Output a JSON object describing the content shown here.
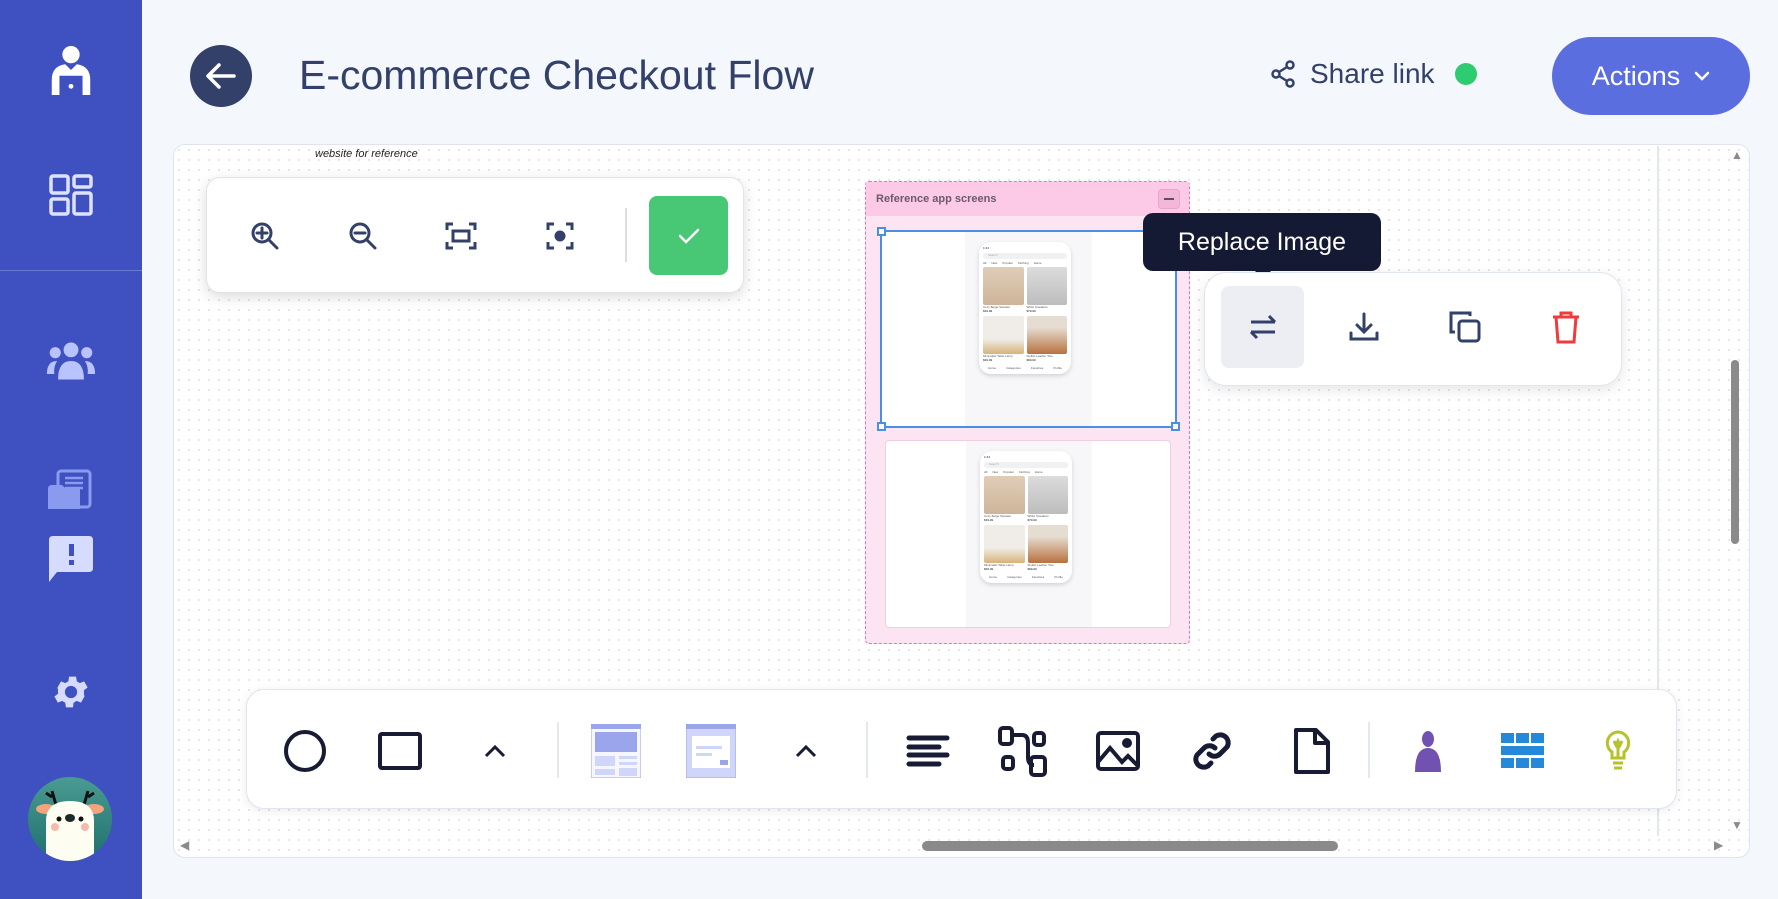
{
  "header": {
    "title": "E-commerce Checkout Flow",
    "share_label": "Share link",
    "actions_label": "Actions"
  },
  "canvas": {
    "note": "website for reference",
    "group": {
      "title": "Reference app screens"
    },
    "phone": {
      "search_placeholder": "Search",
      "tabs": [
        "All",
        "New",
        "Popular",
        "Clothing",
        "Home"
      ],
      "products": [
        {
          "name": "Cozy Beige Sweater",
          "price": "$49.99"
        },
        {
          "name": "White Sneakers",
          "price": "$79.99"
        },
        {
          "name": "Minimalist Table Lamp",
          "price": "$39.99"
        },
        {
          "name": "Stylish Leather Tote",
          "price": "$89.99"
        }
      ],
      "nav": [
        "Home",
        "Categories",
        "Favorites",
        "Profile"
      ]
    },
    "tooltip": "Replace Image"
  },
  "colors": {
    "sidebar": "#3f51c1",
    "accent": "#5b6ee0",
    "success": "#48c774",
    "danger": "#ef3b3b",
    "status_online": "#2ecc71"
  }
}
